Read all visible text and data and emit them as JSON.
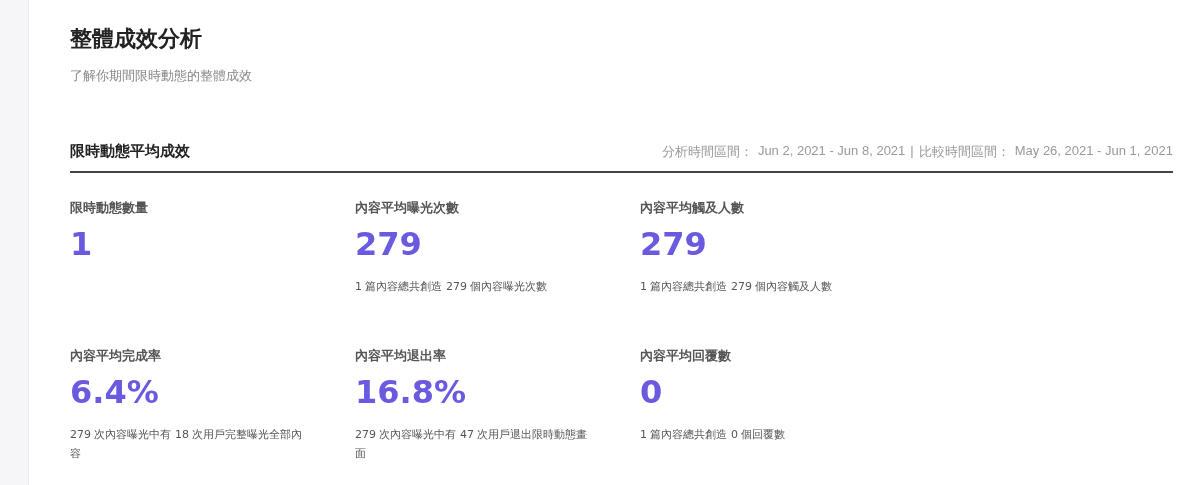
{
  "header": {
    "title": "整體成效分析",
    "subtitle": "了解你期間限時動態的整體成效"
  },
  "section": {
    "title": "限時動態平均成效",
    "analysis_label": "分析時間區間：",
    "analysis_range": "Jun 2, 2021 - Jun 8, 2021",
    "separator": "|",
    "compare_label": "比較時間區間：",
    "compare_range": "May 26, 2021 - Jun 1, 2021"
  },
  "metrics": [
    {
      "label": "限時動態數量",
      "value": "1"
    },
    {
      "label": "內容平均曝光次數",
      "value": "279",
      "caption": "1 篇內容總共創造 279 個內容曝光次數"
    },
    {
      "label": "內容平均觸及人數",
      "value": "279",
      "caption": "1 篇內容總共創造 279 個內容觸及人數"
    },
    {
      "label": "內容平均完成率",
      "value": "6.4%",
      "caption": "279 次內容曝光中有 18 次用戶完整曝光全部內容"
    },
    {
      "label": "內容平均退出率",
      "value": "16.8%",
      "caption": "279 次內容曝光中有 47 次用戶退出限時動態畫面"
    },
    {
      "label": "內容平均回覆數",
      "value": "0",
      "caption": "1 篇內容總共創造 0 個回覆數"
    }
  ]
}
